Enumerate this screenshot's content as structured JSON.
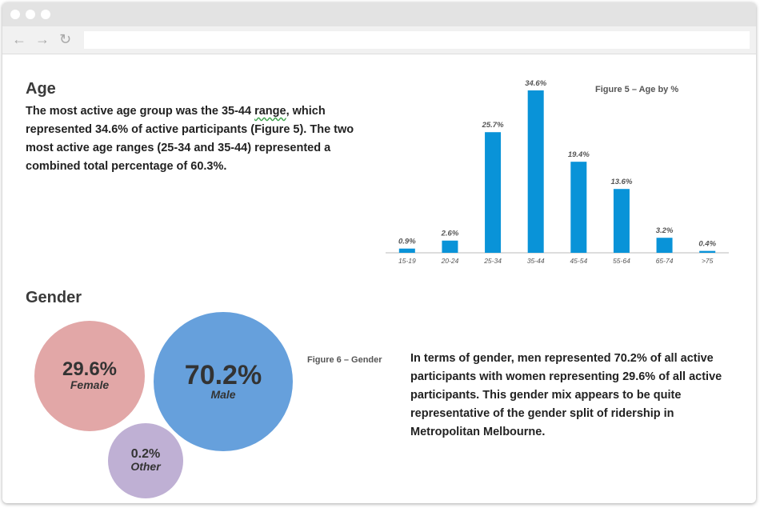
{
  "browser": {
    "url": ""
  },
  "age": {
    "heading": "Age",
    "paragraph": {
      "before": "The most active age group was the 35-44 ",
      "squiggled": "range",
      "after": ", which represented 34.6% of active participants (Figure 5). The two most active age ranges (25-34 and 35-44) represented a combined total percentage of 60.3%."
    },
    "figure_caption": "Figure 5 – Age by %"
  },
  "gender": {
    "heading": "Gender",
    "figure_caption": "Figure 6 – Gender",
    "paragraph": "In terms of gender, men represented 70.2% of all active participants with women representing 29.6% of all active participants. This gender mix appears to be quite representative of the gender split of ridership in Metropolitan Melbourne.",
    "bubbles": [
      {
        "value": "29.6%",
        "label": "Female",
        "color": "#e2a7a7"
      },
      {
        "value": "70.2%",
        "label": "Male",
        "color": "#66a0dc"
      },
      {
        "value": "0.2%",
        "label": "Other",
        "color": "#bfb0d4"
      }
    ]
  },
  "chart_data": [
    {
      "type": "bar",
      "title": "Figure 5 – Age by %",
      "categories": [
        "15-19",
        "20-24",
        "25-34",
        "35-44",
        "45-54",
        "55-64",
        "65-74",
        ">75"
      ],
      "values": [
        0.9,
        2.6,
        25.7,
        34.6,
        19.4,
        13.6,
        3.2,
        0.4
      ],
      "value_labels": [
        "0.9%",
        "2.6%",
        "25.7%",
        "34.6%",
        "19.4%",
        "13.6%",
        "3.2%",
        "0.4%"
      ],
      "ylim": [
        0,
        34.6
      ],
      "color": "#0993d8",
      "grid": false
    },
    {
      "type": "bubble",
      "title": "Figure 6 – Gender",
      "categories": [
        "Female",
        "Male",
        "Other"
      ],
      "values": [
        29.6,
        70.2,
        0.2
      ]
    }
  ]
}
